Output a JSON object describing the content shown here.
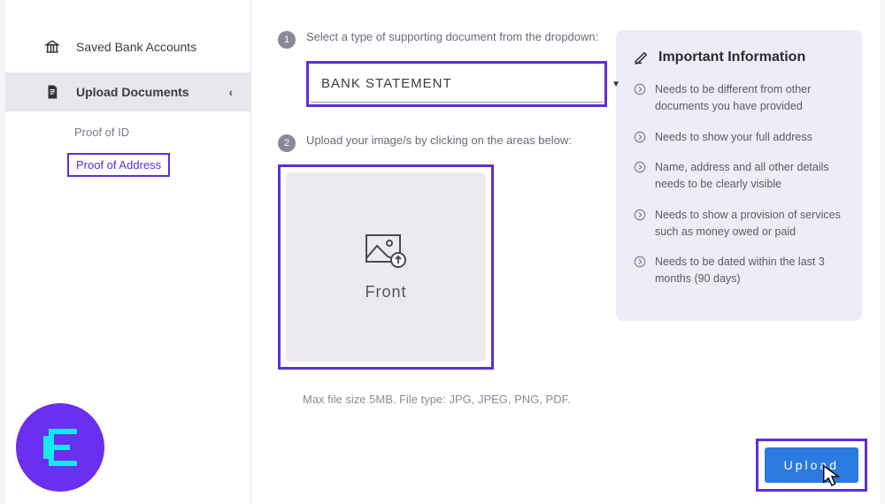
{
  "sidebar": {
    "saved_accounts": "Saved Bank Accounts",
    "upload_documents": "Upload Documents",
    "sub": {
      "proof_id": "Proof of ID",
      "proof_address": "Proof of Address"
    }
  },
  "step1": {
    "num": "1",
    "text": "Select a type of supporting document from the dropdown:",
    "selected": "BANK STATEMENT"
  },
  "step2": {
    "num": "2",
    "text": "Upload your image/s by clicking on the areas below:",
    "caption": "Front"
  },
  "hint": "Max file size 5MB. File type: JPG, JPEG, PNG, PDF.",
  "info": {
    "title": "Important Information",
    "items": [
      "Needs to be different from other documents you have provided",
      "Needs to show your full address",
      "Name, address and all other details needs to be clearly visible",
      "Needs to show a provision of services such as money owed or paid",
      "Needs to be dated within the last 3 months (90 days)"
    ]
  },
  "upload_label": "Upload"
}
